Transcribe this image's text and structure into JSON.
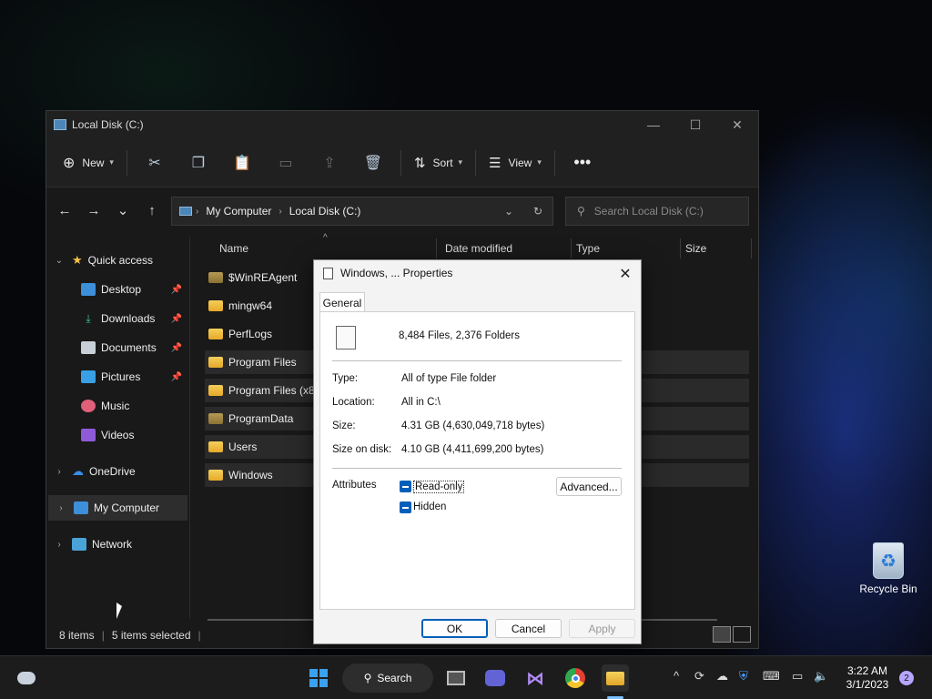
{
  "desktop": {
    "recycle_bin_label": "Recycle Bin"
  },
  "explorer": {
    "title": "Local Disk (C:)",
    "toolbar": {
      "new_label": "New",
      "sort_label": "Sort",
      "view_label": "View"
    },
    "breadcrumb": [
      "My Computer",
      "Local Disk (C:)"
    ],
    "search_placeholder": "Search Local Disk (C:)",
    "nav": {
      "quick_access": "Quick access",
      "desktop": "Desktop",
      "downloads": "Downloads",
      "documents": "Documents",
      "pictures": "Pictures",
      "music": "Music",
      "videos": "Videos",
      "onedrive": "OneDrive",
      "my_computer": "My Computer",
      "network": "Network"
    },
    "columns": {
      "name": "Name",
      "date_modified": "Date modified",
      "type": "Type",
      "size": "Size"
    },
    "files": [
      "$WinREAgent",
      "mingw64",
      "PerfLogs",
      "Program Files",
      "Program Files (x86)",
      "ProgramData",
      "Users",
      "Windows"
    ],
    "status": {
      "items": "8 items",
      "selected": "5 items selected"
    }
  },
  "dialog": {
    "title": "Windows, ... Properties",
    "tab_general": "General",
    "summary": "8,484 Files, 2,376 Folders",
    "type_label": "Type:",
    "type_value": "All of type File folder",
    "location_label": "Location:",
    "location_value": "All in C:\\",
    "size_label": "Size:",
    "size_value": "4.31 GB (4,630,049,718 bytes)",
    "size_on_disk_label": "Size on disk:",
    "size_on_disk_value": "4.10 GB (4,411,699,200 bytes)",
    "attributes_label": "Attributes",
    "readonly_label": "Read-only",
    "hidden_label": "Hidden",
    "advanced_label": "Advanced...",
    "ok_label": "OK",
    "cancel_label": "Cancel",
    "apply_label": "Apply"
  },
  "taskbar": {
    "search_label": "Search",
    "time": "3:22 AM",
    "date": "3/1/2023",
    "notification_count": "2"
  }
}
